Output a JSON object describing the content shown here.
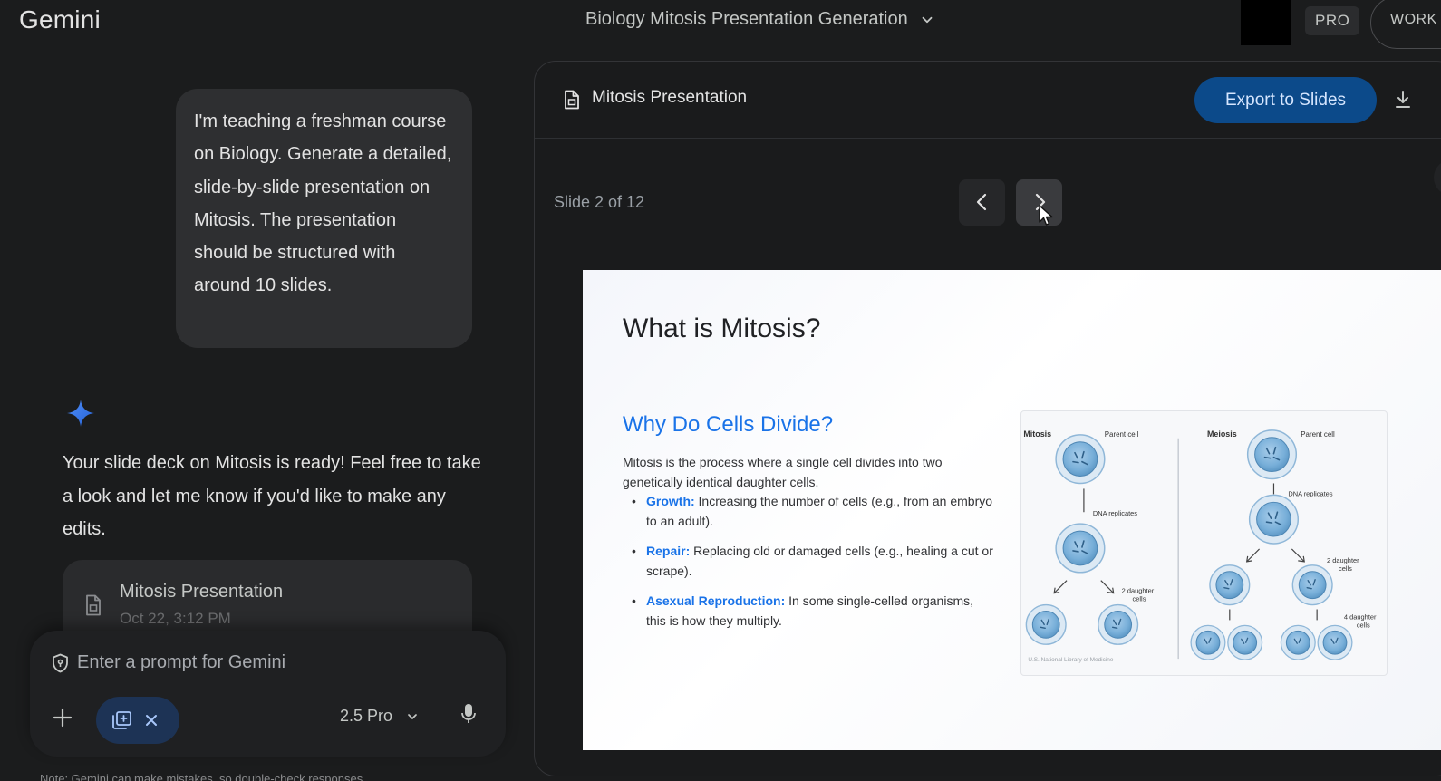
{
  "header": {
    "app_title": "Gemini",
    "chat_title": "Biology Mitosis Presentation Generation",
    "pro_badge": "PRO",
    "work_badge": "WORK"
  },
  "chat": {
    "user_message": "I'm teaching a freshman course on Biology. Generate a detailed, slide-by-slide presentation on Mitosis. The presentation should be structured with around 10 slides.",
    "response": "Your slide deck on Mitosis is ready! Feel free to take a look and let me know if you'd like to make any edits.",
    "doc_card": {
      "title": "Mitosis Presentation",
      "date": "Oct 22, 3:12 PM"
    }
  },
  "prompt": {
    "placeholder": "Enter a prompt for Gemini",
    "model": "2.5 Pro"
  },
  "footnote": "Note: Gemini can make mistakes, so double-check responses",
  "canvas": {
    "title": "Mitosis Presentation",
    "export_label": "Export to Slides",
    "slide_counter": "Slide 2 of 12",
    "slide": {
      "title": "What is Mitosis?",
      "subtitle": "Why Do Cells Divide?",
      "intro": "Mitosis is the process where a single cell divides into two genetically identical daughter cells.",
      "bullets": [
        {
          "term": "Growth:",
          "text": " Increasing the number of cells (e.g., from an embryo to an adult)."
        },
        {
          "term": "Repair:",
          "text": " Replacing old or damaged cells (e.g., healing a cut or scrape)."
        },
        {
          "term": "Asexual Reproduction:",
          "text": " In some single-celled organisms, this is how they multiply."
        }
      ],
      "figure": {
        "mitosis_label": "Mitosis",
        "meiosis_label": "Meiosis",
        "parent_cell": "Parent cell",
        "dna_replicates": "DNA replicates",
        "two_daughter": "2 daughter",
        "four_daughter": "4 daughter",
        "cells": "cells",
        "credit": "U.S. National Library of Medicine"
      }
    }
  },
  "colors": {
    "background": "#1b1c1d",
    "accent": "#1a73e8",
    "export_button": "#0c4a8a"
  },
  "icons": [
    "chevron-down-icon",
    "gemini-star-icon",
    "document-icon",
    "shield-icon",
    "plus-icon",
    "canvas-tool-icon",
    "close-icon",
    "microphone-icon",
    "download-icon",
    "chevron-left-icon",
    "chevron-right-icon",
    "cursor-icon"
  ]
}
